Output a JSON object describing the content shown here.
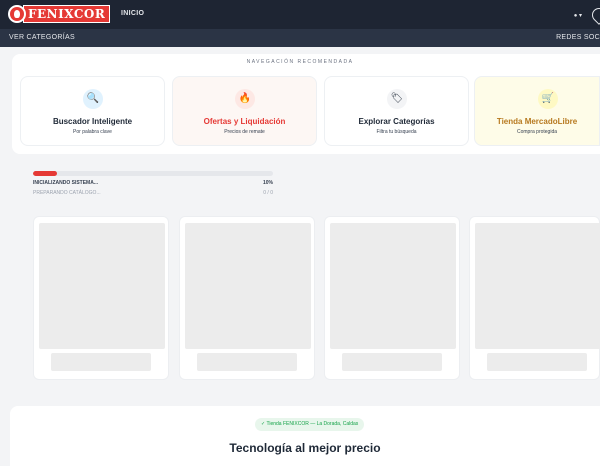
{
  "header": {
    "logo_text": "FENIXCOR",
    "nav_inicio": "INICIO",
    "lang": "● ▾"
  },
  "subnav": {
    "left": "VER CATEGORÍAS",
    "right": "REDES SOC"
  },
  "navigation": {
    "heading": "NAVEGACIÓN RECOMENDADA",
    "cards": [
      {
        "title": "Buscador Inteligente",
        "subtitle": "Por palabra clave",
        "icon": "🔍",
        "icon_name": "search-icon",
        "title_color": "#1f2937",
        "bg": "#ffffff",
        "icon_bg": "#e0f2fe"
      },
      {
        "title": "Ofertas y Liquidación",
        "subtitle": "Precios de remate",
        "icon": "🔥",
        "icon_name": "fire-icon",
        "title_color": "#e53935",
        "bg": "#fdf7f4",
        "icon_bg": "#fde8e4"
      },
      {
        "title": "Explorar Categorías",
        "subtitle": "Filtra tu búsqueda",
        "icon": "🏷",
        "icon_name": "tag-icon",
        "title_color": "#1f2937",
        "bg": "#ffffff",
        "icon_bg": "#f3f4f6"
      },
      {
        "title": "Tienda MercadoLibre",
        "subtitle": "Compra protegida",
        "icon": "🛒",
        "icon_name": "cart-icon",
        "title_color": "#b7791f",
        "bg": "#fefce8",
        "icon_bg": "#fef9c3"
      }
    ]
  },
  "loading": {
    "status": "INICIALIZANDO SISTEMA...",
    "percent_label": "10%",
    "percent": 10,
    "sub_status": "PREPARANDO CATÁLOGO...",
    "count": "0 / 0",
    "accent": "#e53935"
  },
  "footer": {
    "badge": "✓ Tienda FENIXCOR — La Dorada, Caldas",
    "title": "Tecnología al mejor precio"
  }
}
